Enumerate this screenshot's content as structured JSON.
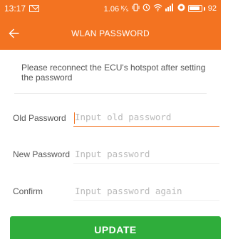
{
  "status_bar": {
    "time": "13:17",
    "network_speed": "1.06 ᴷ⁄ₛ",
    "battery_level": "92",
    "battery_fill": 0.92
  },
  "toolbar": {
    "title": "WLAN PASSWORD",
    "back_icon": "arrow-left-icon"
  },
  "notice": {
    "text": "Please reconnect the ECU's hotspot after setting the password"
  },
  "form": {
    "old_password": {
      "label": "Old Password",
      "placeholder": "Input old password",
      "value": ""
    },
    "new_password": {
      "label": "New Password",
      "placeholder": "Input password",
      "value": ""
    },
    "confirm": {
      "label": "Confirm",
      "placeholder": "Input password again",
      "value": ""
    }
  },
  "update_button": {
    "label": "UPDATE"
  },
  "colors": {
    "brand_orange": "#f37321",
    "button_green": "#2fad3b",
    "label_gray": "#555555",
    "placeholder_gray": "#b9b9b9"
  }
}
